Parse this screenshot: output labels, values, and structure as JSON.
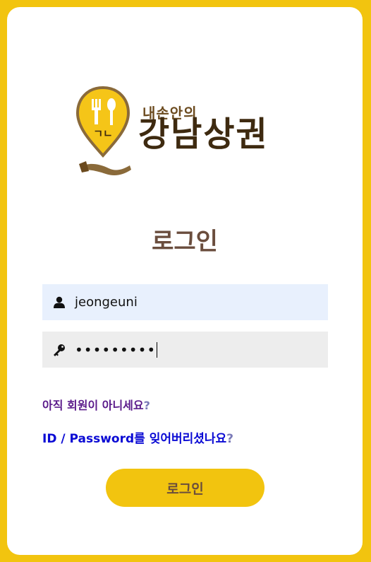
{
  "logo": {
    "subtitle": "내손안의",
    "title": "강남상권",
    "badge": "ㄱㄴ"
  },
  "login": {
    "heading": "로그인",
    "username": {
      "value": "jeongeuni",
      "icon": "user-icon"
    },
    "password": {
      "masked_value": "•••••••••",
      "icon": "key-icon"
    },
    "signup_link": "아직 회원이 아니세요",
    "forgot_link": "ID / Password를 잊어버리셨나요",
    "question_mark": "?",
    "submit_label": "로그인"
  },
  "colors": {
    "background": "#f2c40f",
    "card": "#ffffff",
    "heading": "#6a4d3d",
    "signup_link": "#5a1a8a",
    "forgot_link": "#0a0ad4",
    "username_field": "#e8f0fd",
    "password_field": "#ededed"
  }
}
